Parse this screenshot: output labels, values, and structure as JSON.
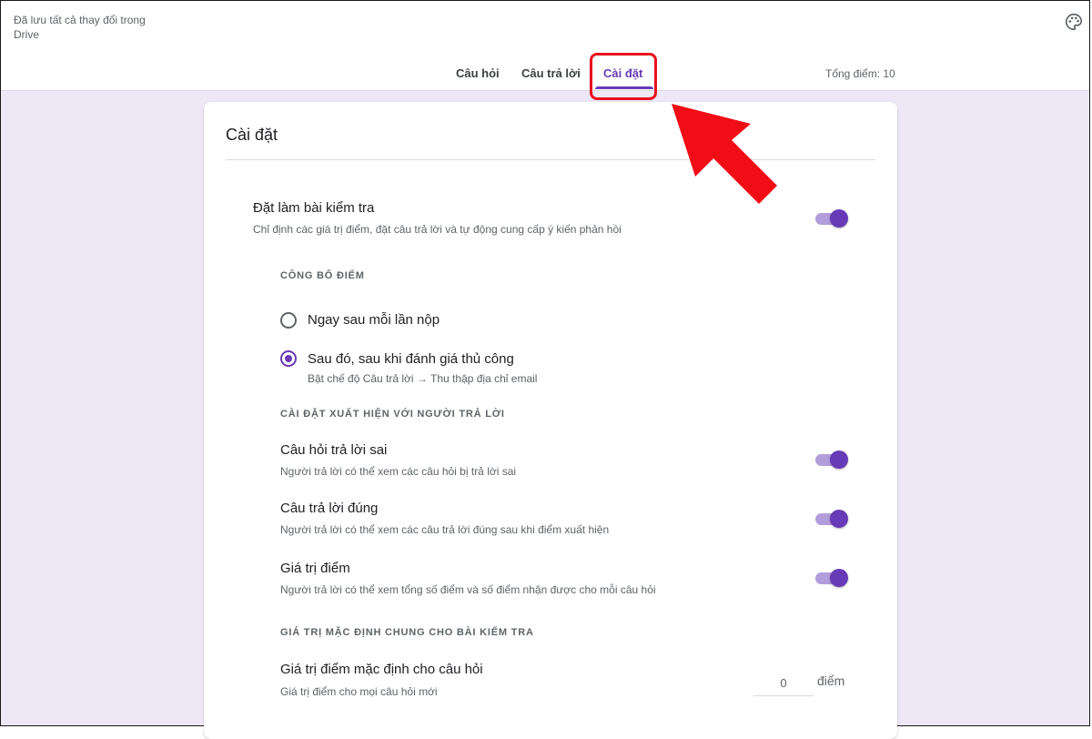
{
  "header": {
    "saved_status": "Đã lưu tất cả thay đổi trong Drive",
    "tabs": [
      {
        "label": "Câu hỏi"
      },
      {
        "label": "Câu trả lời"
      },
      {
        "label": "Cài đặt"
      }
    ],
    "total_points": "Tổng điểm: 10",
    "icons": {
      "palette": "palette-icon"
    }
  },
  "settings": {
    "title": "Cài đặt",
    "quiz": {
      "title": "Đặt làm bài kiểm tra",
      "description": "Chỉ định các giá trị điểm, đặt câu trả lời và tự động cung cấp ý kiến phản hồi",
      "enabled": true
    },
    "release_section": "CÔNG BỐ ĐIỂM",
    "release_options": [
      {
        "label": "Ngay sau mỗi lần nộp",
        "selected": false
      },
      {
        "label": "Sau đó, sau khi đánh giá thủ công",
        "selected": true,
        "note": "Bật chế độ Câu trả lời → Thu thập địa chỉ email"
      }
    ],
    "respondent_section": "CÀI ĐẶT XUẤT HIỆN VỚI NGƯỜI TRẢ LỜI",
    "respondent_options": [
      {
        "title": "Câu hỏi trả lời sai",
        "description": "Người trả lời có thể xem các câu hỏi bị trả lời sai",
        "enabled": true
      },
      {
        "title": "Câu trả lời đúng",
        "description": "Người trả lời có thể xem các câu trả lời đúng sau khi điểm xuất hiện",
        "enabled": true
      },
      {
        "title": "Giá trị điểm",
        "description": "Người trả lời có thể xem tổng số điểm và số điểm nhận được cho mỗi câu hỏi",
        "enabled": true
      }
    ],
    "defaults_section": "GIÁ TRỊ MẶC ĐỊNH CHUNG CHO BÀI KIỂM TRA",
    "default_points": {
      "title": "Giá trị điểm mặc định cho câu hỏi",
      "description": "Giá trị điểm cho mọi câu hỏi mới",
      "value": "0",
      "unit": "điểm"
    }
  },
  "colors": {
    "accent": "#673ab7",
    "highlight": "#e8121e",
    "background": "#ede7f6"
  }
}
